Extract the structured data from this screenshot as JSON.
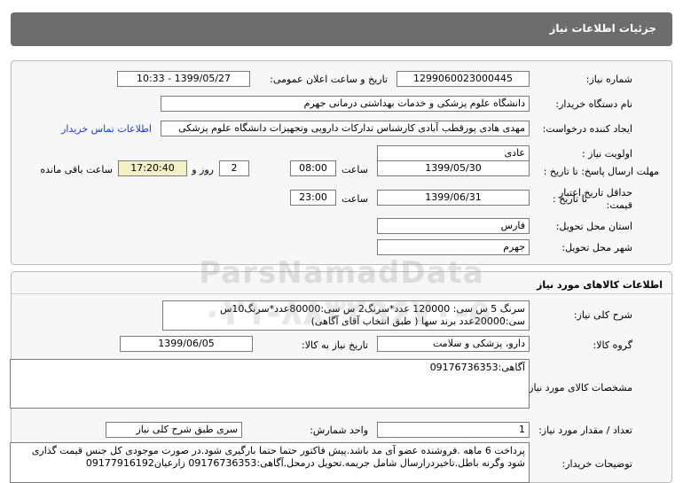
{
  "header": {
    "title": "جزئیات اطلاعات نیاز"
  },
  "details": {
    "need_number_label": "شماره نیاز:",
    "need_number": "1299060023000445",
    "announce_label": "تاریخ و ساعت اعلان عمومی:",
    "announce_value": "1399/05/27 - 10:33",
    "buyer_label": "نام دستگاه خریدار:",
    "buyer_value": "دانشگاه علوم پزشکی و خدمات بهداشتی درمانی جهرم",
    "creator_label": "ایجاد کننده درخواست:",
    "creator_value": "مهدی هادی پورقطب آبادی کارشناس تدارکات دارویی وتجهیزات دانشگاه علوم پزشکی",
    "contact_link": "اطلاعات تماس خریدار",
    "priority_label": "اولویت نیاز :",
    "priority_value": "عادی",
    "deadline_label": "مهلت ارسال پاسخ: تا تاریخ :",
    "deadline_date": "1399/05/30",
    "time_label": "ساعت",
    "deadline_time": "08:00",
    "days_value": "2",
    "days_label": "روز و",
    "remaining_value": "17:20:40",
    "remaining_label": "ساعت باقی مانده",
    "validity_label_line1": "حداقل تاریخ اعتبار",
    "validity_label_line2": "قیمت:",
    "validity_to_label": "تا تاریخ :",
    "validity_date": "1399/06/31",
    "validity_time_label": "ساعت",
    "validity_time": "23:00",
    "province_label": "استان محل تحویل:",
    "province_value": "فارس",
    "city_label": "شهر محل تحویل:",
    "city_value": "جهرم"
  },
  "goods": {
    "section_title": "اطلاعات کالاهای مورد نیاز",
    "desc_label": "شرح کلی نیاز:",
    "desc_value": "سرنگ 5 س سی: 120000 عدد*سرنگ2 س سی:80000عدد*سرنگ10س سی:20000عدد برند سها ( طبق انتخاب آقای آگاهی)",
    "group_label": "گروه کالا:",
    "group_value": "دارو، پزشکی و سلامت",
    "need_date_label": "تاریخ نیاز به کالا:",
    "need_date_value": "1399/06/05",
    "specs_label": "مشخصات کالای مورد نیاز:",
    "specs_value": "آگاهی:09176736353",
    "unit_label": "واحد شمارش:",
    "unit_value": "سری طبق شرح کلی نیاز",
    "qty_label": "تعداد / مقدار مورد نیاز:",
    "qty_value": "1",
    "buyer_notes_label": "توضیحات خریدار:",
    "buyer_notes_value": "پرداخت 6 ماهه .فروشنده عضو آی مد باشد.پیش فاکتور حتما حتما بارگیری شود.در صورت موجودی کل جنس قیمت گذاری شود وگرنه باطل.تاخیردرارسال شامل جریمه.تحویل درمحل.آگاهی:09176736353 زارعیان09177916192"
  },
  "watermark": {
    "brand": "ParsNamadData",
    "phone": "۰۲۱-۸۸۳۴۹۶۷۰-۵"
  }
}
